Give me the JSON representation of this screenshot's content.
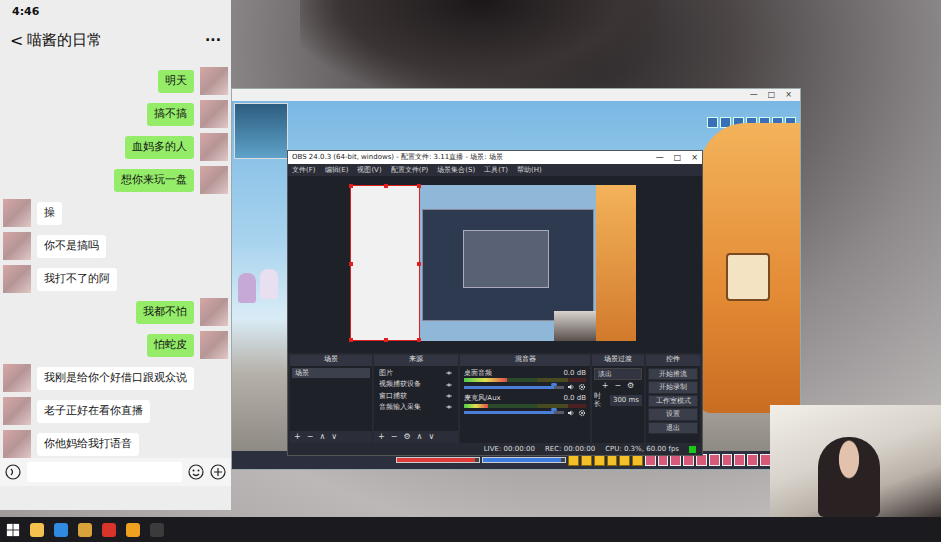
{
  "phone": {
    "time": "4:46",
    "back": "<",
    "title": "喵酱的日常",
    "more": "···",
    "messages": [
      {
        "text": "明天",
        "kind": "sent"
      },
      {
        "text": "搞不搞",
        "kind": "sent"
      },
      {
        "text": "血妈多的人",
        "kind": "sent"
      },
      {
        "text": "想你来玩一盘",
        "kind": "sent"
      },
      {
        "text": "操",
        "kind": "received"
      },
      {
        "text": "你不是搞吗",
        "kind": "received"
      },
      {
        "text": "我打不了的阿",
        "kind": "received"
      },
      {
        "text": "我都不怕",
        "kind": "sent"
      },
      {
        "text": "怕蛇皮",
        "kind": "sent"
      },
      {
        "text": "我刚是给你个好借口跟观众说",
        "kind": "received"
      },
      {
        "text": "老子正好在看你直播",
        "kind": "received"
      },
      {
        "text": "你他妈给我打语音",
        "kind": "received"
      }
    ]
  },
  "game": {
    "window_buttons": [
      "—",
      "□",
      "×"
    ],
    "hp_level": 0.95,
    "mp_level": 0.95
  },
  "obs": {
    "title": "OBS 24.0.3 (64-bit, windows) - 配置文件: 3.11直播 - 场景: 场景",
    "window_buttons": [
      "—",
      "□",
      "×"
    ],
    "menu": [
      "文件(F)",
      "编辑(E)",
      "视图(V)",
      "配置文件(P)",
      "场景集合(S)",
      "工具(T)",
      "帮助(H)"
    ],
    "scenes": {
      "title": "场景",
      "items": [
        {
          "label": "场景",
          "selected": true
        }
      ],
      "tools": [
        "+",
        "−",
        "∧",
        "∨"
      ]
    },
    "sources": {
      "title": "来源",
      "items": [
        {
          "label": "图片",
          "visible": true
        },
        {
          "label": "视频捕获设备",
          "visible": true
        },
        {
          "label": "窗口捕获",
          "visible": true
        },
        {
          "label": "音频输入采集",
          "visible": true
        }
      ],
      "tools": [
        "+",
        "−",
        "⚙",
        "∧",
        "∨"
      ]
    },
    "mixer": {
      "title": "混音器",
      "channels": [
        {
          "name": "桌面音频",
          "reading": "0.0 dB",
          "meter": 0.35,
          "volume": 0.9,
          "muted": false
        },
        {
          "name": "麦克风/Aux",
          "reading": "0.0 dB",
          "meter": 0.2,
          "volume": 0.9,
          "muted": false
        }
      ]
    },
    "transitions": {
      "title": "场景过渡",
      "type": "淡出",
      "tools": [
        "+",
        "−",
        "⚙"
      ],
      "duration_label": "时长",
      "duration": "300 ms"
    },
    "controls": {
      "title": "控件",
      "buttons": [
        "开始推流",
        "开始录制",
        "工作室模式",
        "设置",
        "退出"
      ]
    },
    "status": {
      "items": [
        "LIVE: 00:00:00",
        "REC: 00:00:00",
        "CPU: 0.3%, 60.00 fps"
      ],
      "network_ok": true
    }
  }
}
